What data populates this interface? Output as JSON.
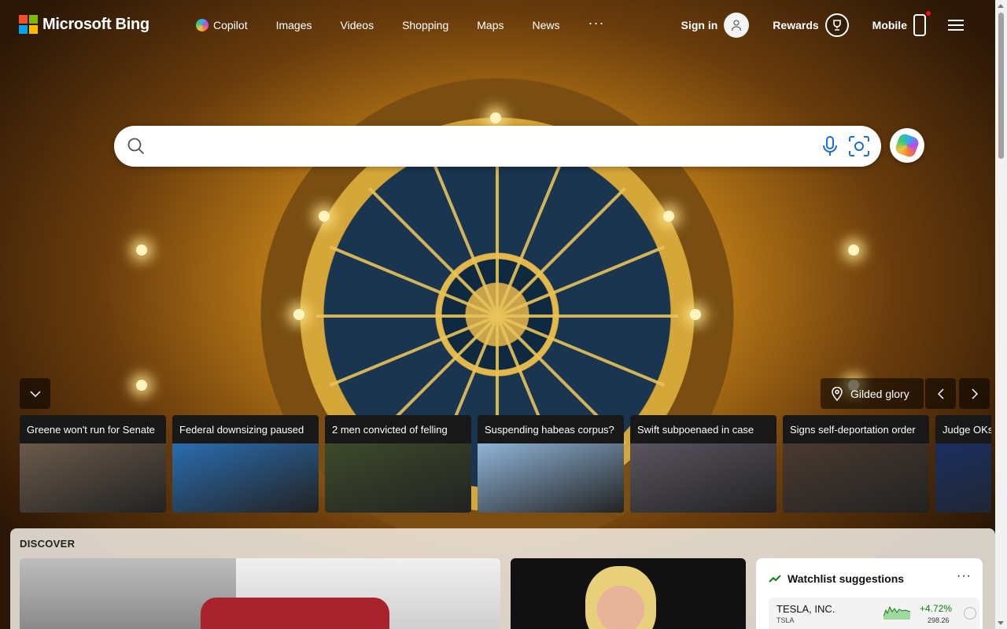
{
  "brand": {
    "name": "Microsoft Bing",
    "logo_colors": [
      "#f25022",
      "#7fba00",
      "#00a4ef",
      "#ffb900"
    ]
  },
  "nav": {
    "items": [
      "Copilot",
      "Images",
      "Videos",
      "Shopping",
      "Maps",
      "News"
    ],
    "more": "···"
  },
  "account": {
    "sign_in": "Sign in",
    "rewards": "Rewards",
    "mobile": "Mobile"
  },
  "search": {
    "placeholder": "",
    "value": ""
  },
  "image_info": {
    "title": "Gilded glory",
    "icon": "location-pin-icon"
  },
  "news": [
    {
      "title": "Greene won't run for Senate",
      "color": "#6b5a4a"
    },
    {
      "title": "Federal downsizing paused",
      "color": "#2a6db0"
    },
    {
      "title": "2 men convicted of felling",
      "color": "#3d4a2a"
    },
    {
      "title": "Suspending habeas corpus?",
      "color": "#8fb4d8"
    },
    {
      "title": "Swift subpoenaed in case",
      "color": "#5a5560"
    },
    {
      "title": "Signs self-deportation order",
      "color": "#4a3a30"
    },
    {
      "title": "Judge OKs",
      "color": "#1a2f60"
    }
  ],
  "discover": {
    "title": "DISCOVER"
  },
  "watchlist": {
    "title": "Watchlist suggestions",
    "more": "···",
    "stocks": [
      {
        "name": "TESLA, INC.",
        "symbol": "TSLA",
        "change": "+4.72%",
        "price": "298.26",
        "trend": "up"
      }
    ]
  }
}
